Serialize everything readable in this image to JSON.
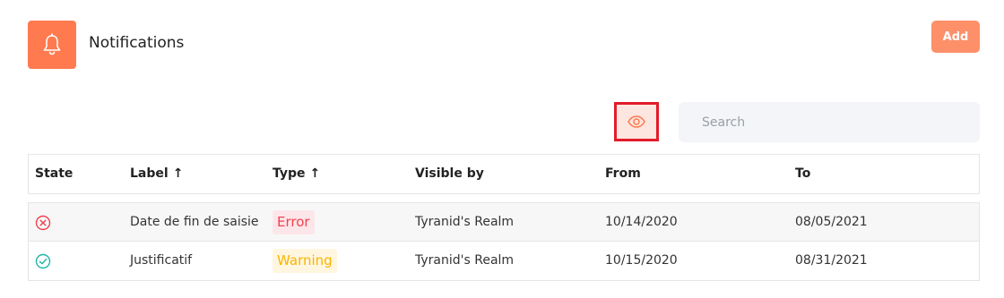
{
  "header": {
    "title": "Notifications",
    "icon": "bell-icon",
    "accent_color": "#ff7a4f"
  },
  "toolbar": {
    "add_label": "Add",
    "visibility_icon": "eye-icon",
    "search_placeholder": "Search",
    "search_value": ""
  },
  "table": {
    "columns": [
      {
        "label": "State",
        "sort": ""
      },
      {
        "label": "Label",
        "sort": "↑"
      },
      {
        "label": "Type",
        "sort": "↑"
      },
      {
        "label": "Visible by",
        "sort": ""
      },
      {
        "label": "From",
        "sort": ""
      },
      {
        "label": "To",
        "sort": ""
      }
    ],
    "rows": [
      {
        "state_icon": "error-circle-icon",
        "state_color": "#f1414e",
        "label": "Date de fin de saisie",
        "type": "Error",
        "visible_by": "Tyranid's Realm",
        "from": "10/14/2020",
        "to": "08/05/2021"
      },
      {
        "state_icon": "check-circle-icon",
        "state_color": "#1fb5a5",
        "label": "Justificatif",
        "type": "Warning",
        "visible_by": "Tyranid's Realm",
        "from": "10/15/2020",
        "to": "08/31/2021"
      }
    ]
  }
}
